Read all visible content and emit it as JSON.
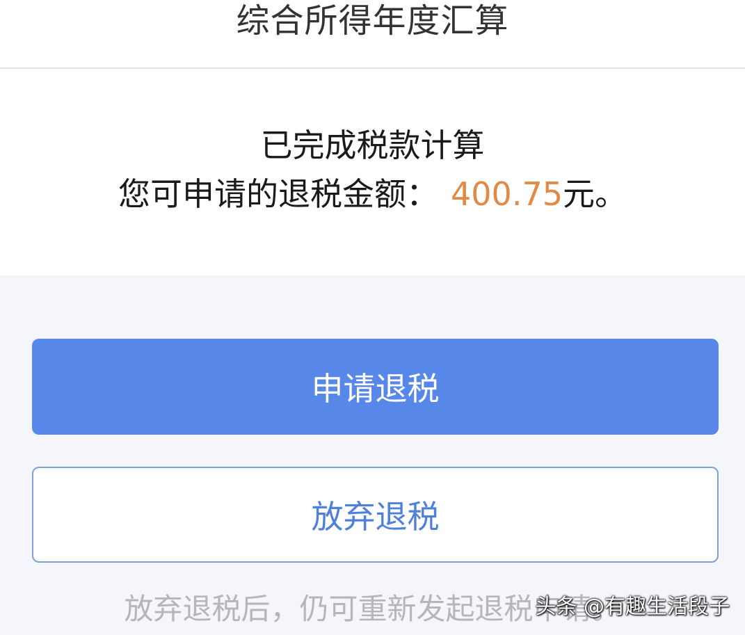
{
  "header": {
    "title": "综合所得年度汇算"
  },
  "result": {
    "line1": "已完成税款计算",
    "line2_prefix": "您可申请的退税金额：",
    "amount": "400.75",
    "line2_suffix": "元。"
  },
  "actions": {
    "apply_label": "申请退税",
    "abandon_label": "放弃退税"
  },
  "note": "放弃退税后，仍可重新发起退税申请。",
  "watermark": "头条 @有趣生活段子",
  "colors": {
    "primary": "#5687e9",
    "amount": "#e08a45",
    "secondary_text": "#4f80dc",
    "note_text": "#b4b6bb"
  }
}
